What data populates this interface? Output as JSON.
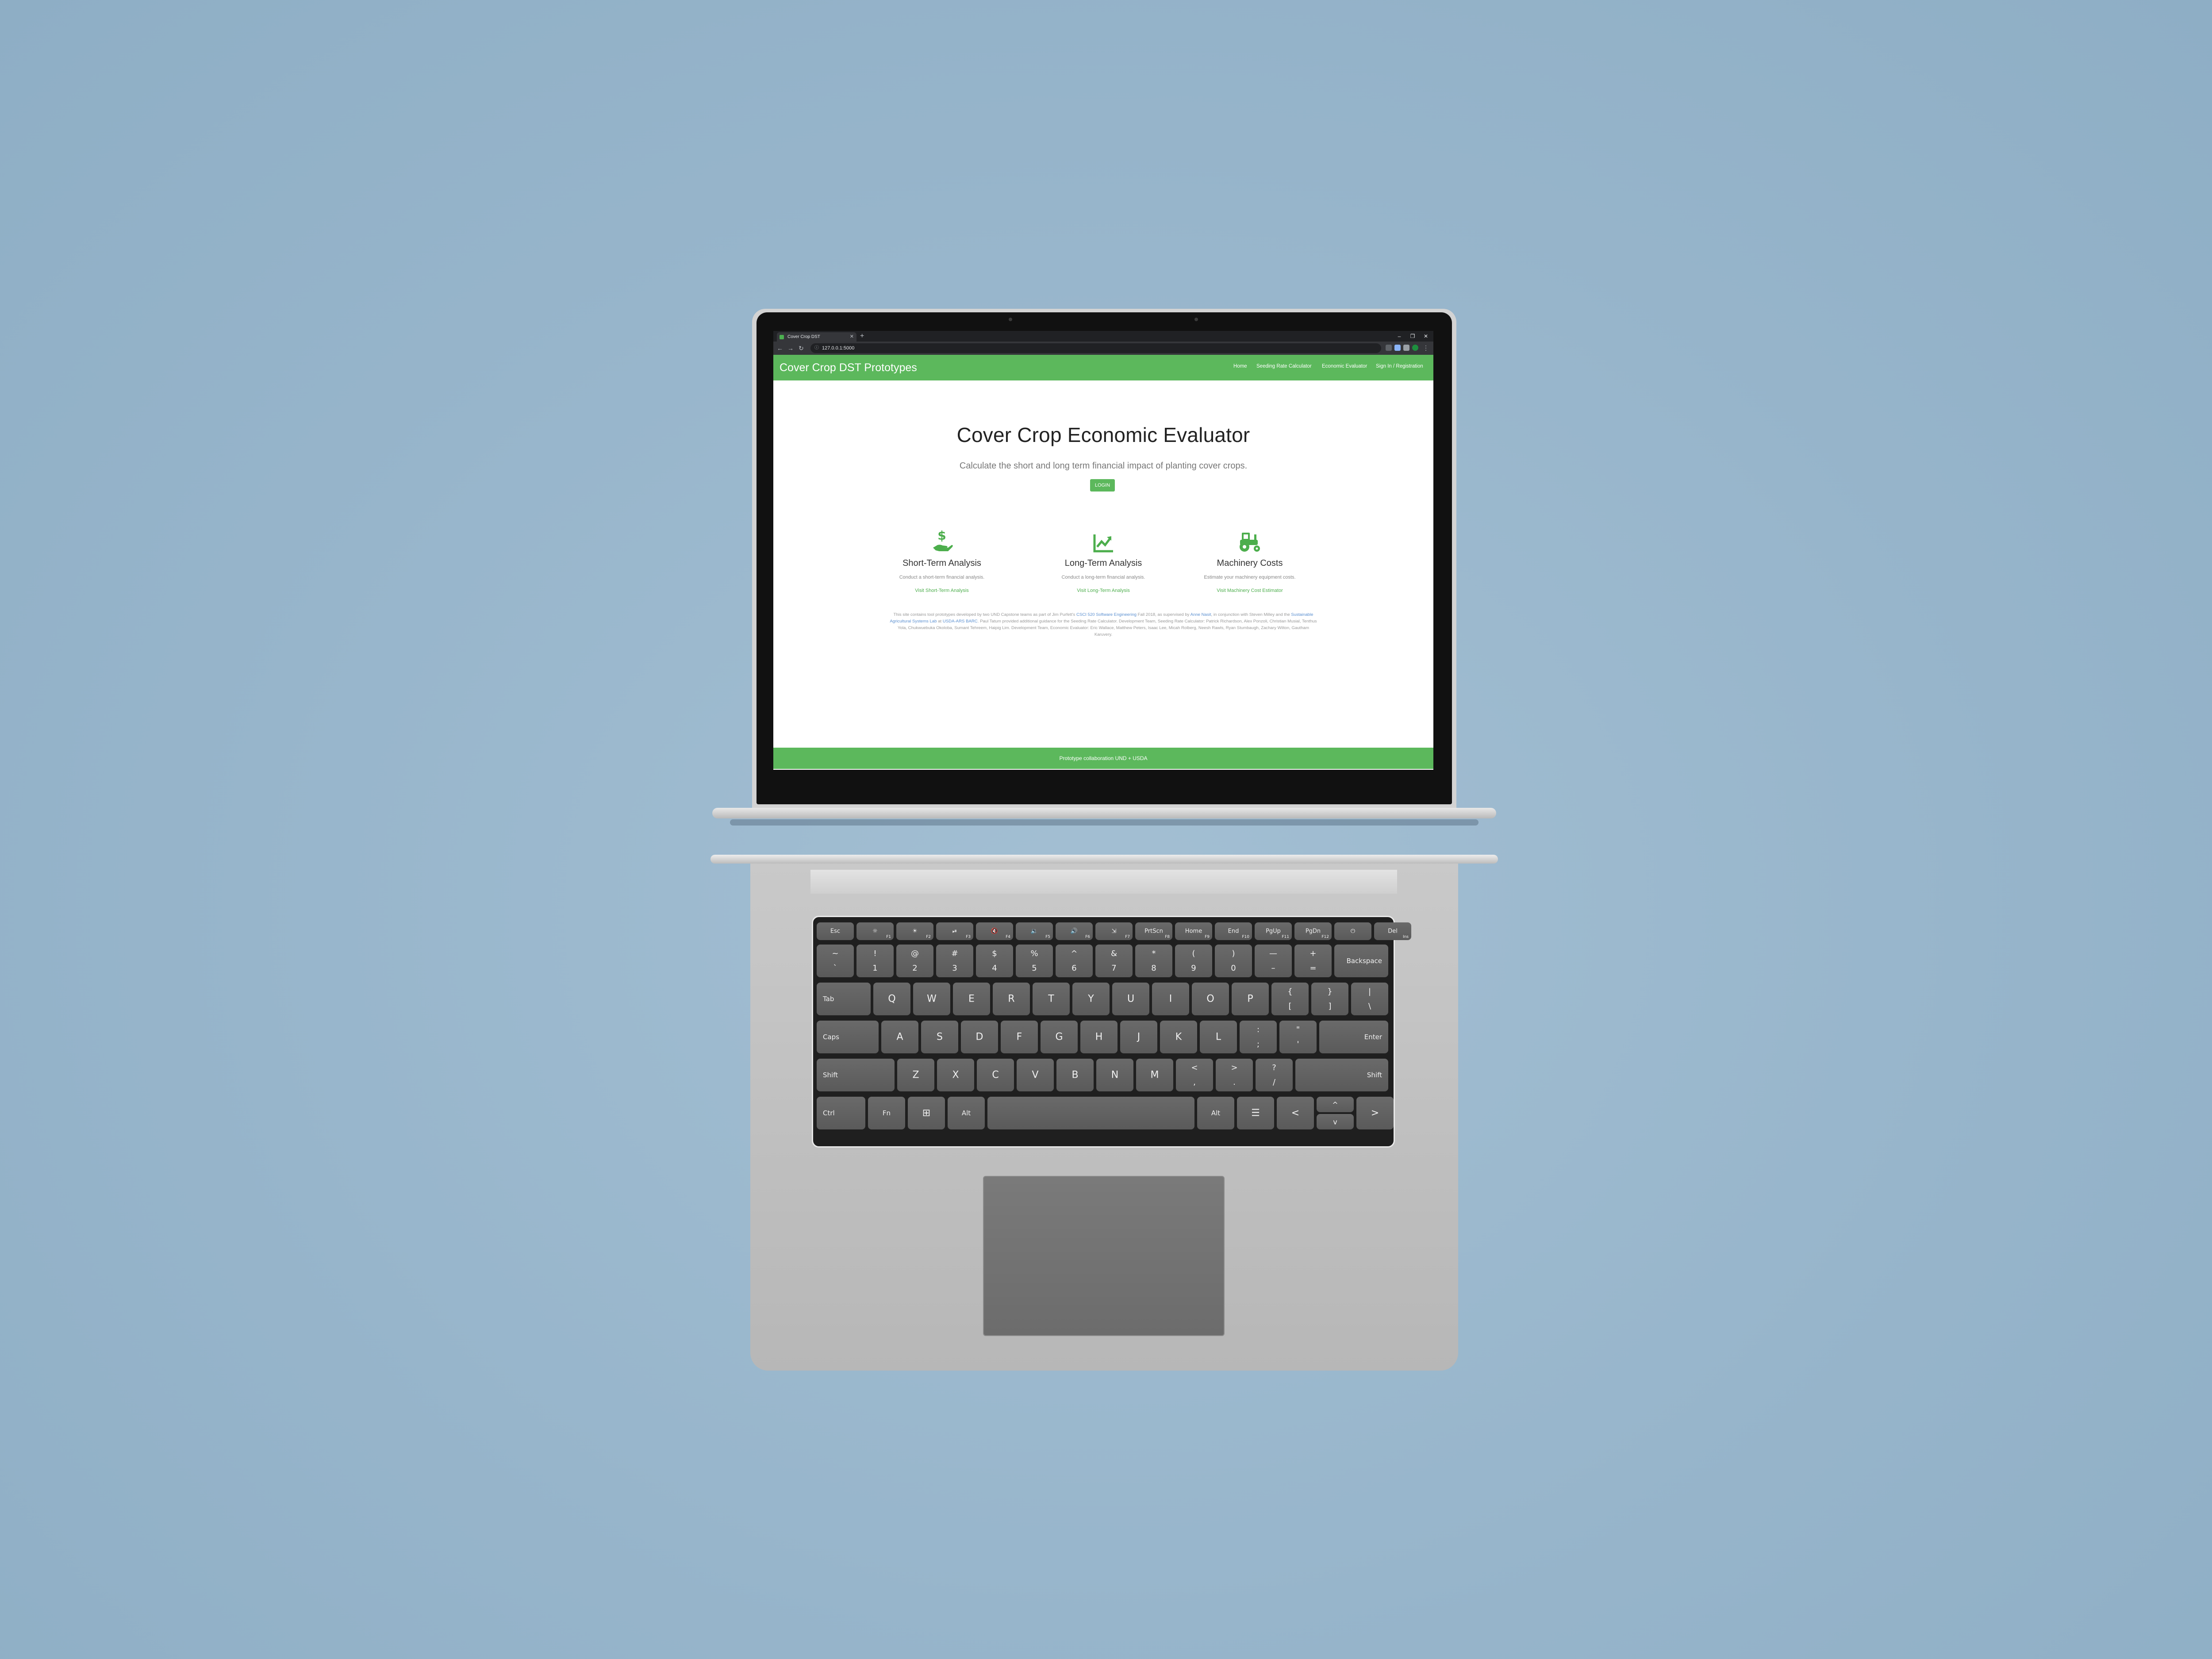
{
  "browser": {
    "tab_title": "Cover Crop DST",
    "tab_close": "✕",
    "new_tab": "+",
    "address": "127.0.0.1:5000",
    "window_controls": [
      "–",
      "❐",
      "✕"
    ],
    "nav_buttons": [
      "←",
      "→",
      "↻"
    ]
  },
  "navbar": {
    "brand": "Cover Crop DST Prototypes",
    "links": [
      "Home",
      "Seeding Rate Calculator",
      "Economic Evaluator",
      "Sign In / Registration"
    ]
  },
  "hero": {
    "title": "Cover Crop Economic Evaluator",
    "subtitle": "Calculate the short and long term financial impact of planting cover crops.",
    "login_button": "LOGIN"
  },
  "features": [
    {
      "icon": "hand-dollar-icon",
      "title": "Short-Term Analysis",
      "description": "Conduct a short-term financial analysis.",
      "link": "Visit Short-Term Analysis"
    },
    {
      "icon": "chart-line-icon",
      "title": "Long-Term Analysis",
      "description": "Conduct a long-term financial analysis.",
      "link": "Visit Long-Term Analysis"
    },
    {
      "icon": "tractor-icon",
      "title": "Machinery Costs",
      "description": "Estimate your machinery equipment costs.",
      "link": "Visit Machinery Cost Estimator"
    }
  ],
  "credits": {
    "p1": "This site contains tool prototypes developed by two UND Capstone teams as part of Jim Purfett's ",
    "link1": "CSCI 520 Software Engineering",
    "p2": " Fall 2018, as supervised by ",
    "link2": "Anne Nasit",
    "p3": ", in conjunction with Steven Milley and the ",
    "link3": "Sustainable Agricultural Systems Lab",
    "p4": " at ",
    "link4": "USDA-ARS BARC",
    "p5": ". Paul Tatum provided additional guidance for the Seeding Rate Calculator. Development Team, Seeding Rate Calculator: Patrick Richardson, Alex Ponzoli, Christian Musial, Tenthus Yola, Chukwuebuka Okoloba, Sumant Tehreem, Haipig Lim. Development Team, Economic Evaluator: Eric Wallace, Matthew Peters, Isaac Lee, Micah Rolberg, Neesh Rawls, Ryan Stumbaugh, Zachary Wilton, Gautham Karuvery."
  },
  "footer": "Prototype collaboration UND + USDA",
  "keyboard": {
    "fn_row": [
      "Esc",
      "☼",
      "☀",
      "⏯",
      "🔇",
      "🔉",
      "🔊",
      "⇲",
      "PrtScn",
      "Home",
      "End",
      "PgUp",
      "PgDn",
      "⏻",
      "Del"
    ],
    "fn_sub": [
      "",
      "F1",
      "F2",
      "F3",
      "F4",
      "F5",
      "F6",
      "F7",
      "F8",
      "F9",
      "F10",
      "F11",
      "F12",
      "",
      "Ins"
    ],
    "num_top": [
      "~",
      "!",
      "@",
      "#",
      "$",
      "%",
      "^",
      "&",
      "*",
      "(",
      ")",
      "—",
      "+"
    ],
    "num_bot": [
      "`",
      "1",
      "2",
      "3",
      "4",
      "5",
      "6",
      "7",
      "8",
      "9",
      "0",
      "–",
      "="
    ],
    "backspace": "Backspace",
    "tab": "Tab",
    "row_q": [
      "Q",
      "W",
      "E",
      "R",
      "T",
      "Y",
      "U",
      "I",
      "O",
      "P"
    ],
    "row_q_extra_top": [
      "{",
      "}",
      "|"
    ],
    "row_q_extra_bot": [
      "[",
      "]",
      "\\"
    ],
    "caps": "Caps",
    "row_a": [
      "A",
      "S",
      "D",
      "F",
      "G",
      "H",
      "J",
      "K",
      "L"
    ],
    "row_a_extra_top": [
      ":",
      "\""
    ],
    "row_a_extra_bot": [
      ";",
      "'"
    ],
    "enter": "Enter",
    "shift": "Shift",
    "row_z": [
      "Z",
      "X",
      "C",
      "V",
      "B",
      "N",
      "M"
    ],
    "row_z_extra_top": [
      "<",
      ">",
      "?"
    ],
    "row_z_extra_bot": [
      ",",
      ".",
      "/"
    ],
    "ctrl": "Ctrl",
    "fn": "Fn",
    "win": "⊞",
    "alt": "Alt",
    "menu": "☰",
    "arrows": [
      "<",
      "^",
      "v",
      ">"
    ]
  },
  "colors": {
    "brand_green": "#5cb85c",
    "background_blue": "#97b5cb"
  }
}
